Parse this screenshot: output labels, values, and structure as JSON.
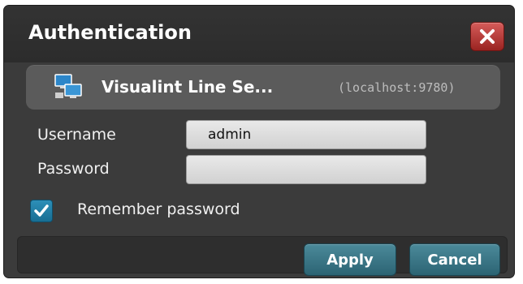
{
  "dialog": {
    "title": "Authentication",
    "close_icon": "close-icon"
  },
  "server": {
    "icon": "network-computers-icon",
    "name": "Visualint Line Se...",
    "host": "(localhost:9780)"
  },
  "form": {
    "username_label": "Username",
    "username_value": "admin",
    "password_label": "Password",
    "password_value": "",
    "remember_label": "Remember password",
    "remember_checked": true
  },
  "footer": {
    "apply_label": "Apply",
    "cancel_label": "Cancel"
  },
  "colors": {
    "dialog_bg": "#3b3b3b",
    "close_button": "#b33b38",
    "button_accent": "#3a7584",
    "checkbox_accent": "#2383ab"
  }
}
